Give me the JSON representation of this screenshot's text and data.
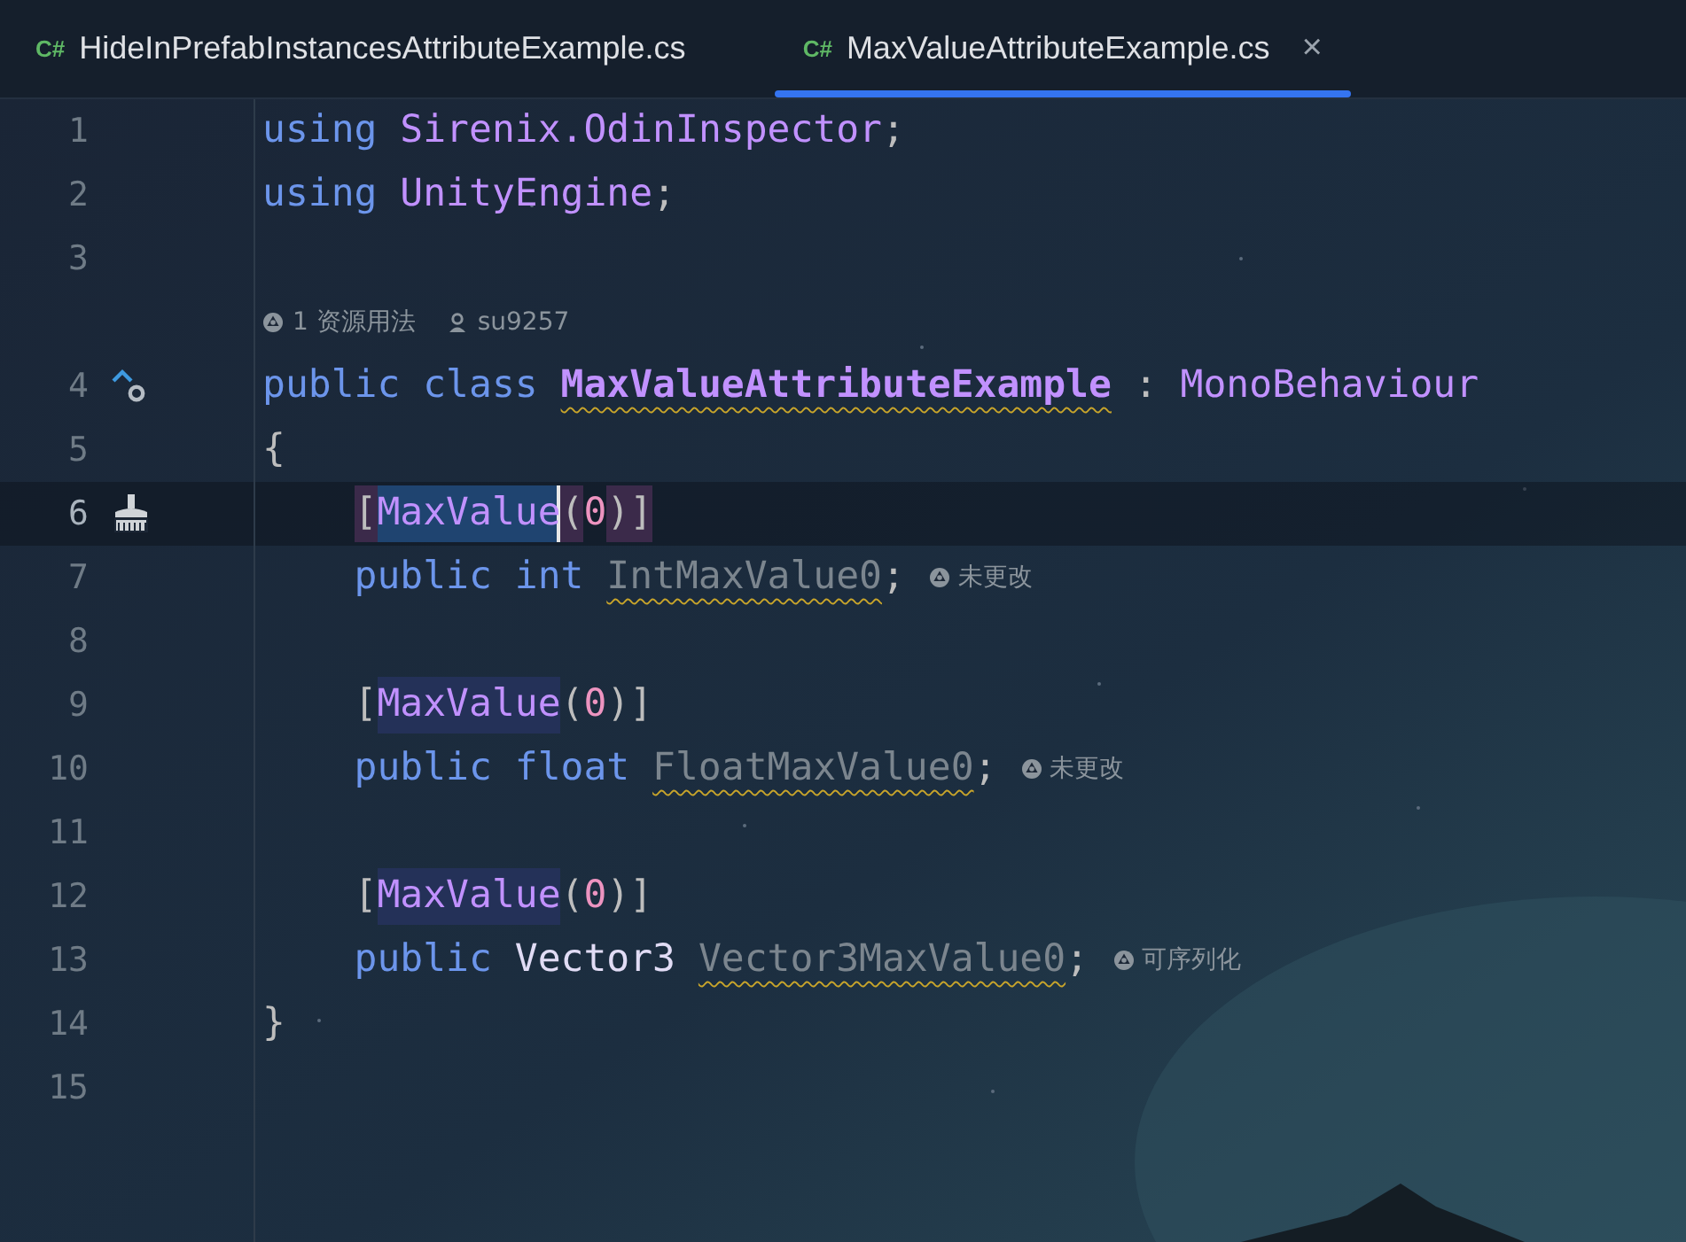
{
  "tabs": [
    {
      "badge": "C#",
      "label": "HideInPrefabInstancesAttributeExample.cs",
      "selected": false
    },
    {
      "badge": "C#",
      "label": "MaxValueAttributeExample.cs",
      "selected": true,
      "close": "×"
    }
  ],
  "editor": {
    "lines": [
      {
        "number": "1",
        "tokens": [
          {
            "kind": "keyword",
            "text": "using "
          },
          {
            "kind": "namespace",
            "text": "Sirenix.OdinInspector"
          },
          {
            "kind": "punct",
            "text": ";"
          }
        ]
      },
      {
        "number": "2",
        "tokens": [
          {
            "kind": "keyword",
            "text": "using "
          },
          {
            "kind": "namespace",
            "text": "UnityEngine"
          },
          {
            "kind": "punct",
            "text": ";"
          }
        ]
      },
      {
        "number": "3"
      },
      {
        "kind": "code_vision",
        "items": [
          {
            "kind": "usages",
            "text": "1 资源用法"
          },
          {
            "kind": "author",
            "text": "su9257"
          }
        ]
      },
      {
        "number": "4",
        "gutter": {
          "kind": "implements"
        },
        "tokens": [
          {
            "kind": "keyword",
            "text": "public class "
          },
          {
            "kind": "classname",
            "text": "MaxValueAttributeExample",
            "warning": true
          },
          {
            "kind": "punct",
            "text": " : "
          },
          {
            "kind": "type",
            "text": "MonoBehaviour"
          }
        ]
      },
      {
        "number": "5",
        "tokens": [
          {
            "kind": "punct",
            "text": "{"
          }
        ]
      },
      {
        "number": "6",
        "current": true,
        "gutter": {
          "kind": "brush"
        },
        "indented": true,
        "tokens": [
          {
            "kind": "punct",
            "text": "[",
            "brace_match": true
          },
          {
            "kind": "attribute",
            "text": "MaxValue",
            "selected": true,
            "caret": true
          },
          {
            "kind": "punct",
            "text": "(",
            "brace_match": true
          },
          {
            "kind": "number",
            "text": "0"
          },
          {
            "kind": "punct",
            "text": ")]",
            "brace_match": true
          }
        ]
      },
      {
        "number": "7",
        "indented": true,
        "tokens": [
          {
            "kind": "keyword",
            "text": "public int "
          },
          {
            "kind": "field",
            "text": "IntMaxValue0",
            "warning": true
          },
          {
            "kind": "punct",
            "text": ";"
          }
        ],
        "hint": "未更改"
      },
      {
        "number": "8"
      },
      {
        "number": "9",
        "indented": true,
        "tokens": [
          {
            "kind": "punct",
            "text": "["
          },
          {
            "kind": "attribute",
            "text": "MaxValue",
            "usage": true
          },
          {
            "kind": "punct",
            "text": "("
          },
          {
            "kind": "number",
            "text": "0"
          },
          {
            "kind": "punct",
            "text": ")]"
          }
        ]
      },
      {
        "number": "10",
        "indented": true,
        "tokens": [
          {
            "kind": "keyword",
            "text": "public float "
          },
          {
            "kind": "field",
            "text": "FloatMaxValue0",
            "warning": true
          },
          {
            "kind": "punct",
            "text": ";"
          }
        ],
        "hint": "未更改"
      },
      {
        "number": "11"
      },
      {
        "number": "12",
        "indented": true,
        "tokens": [
          {
            "kind": "punct",
            "text": "["
          },
          {
            "kind": "attribute",
            "text": "MaxValue",
            "usage": true
          },
          {
            "kind": "punct",
            "text": "("
          },
          {
            "kind": "number",
            "text": "0"
          },
          {
            "kind": "punct",
            "text": ")]"
          }
        ]
      },
      {
        "number": "13",
        "indented": true,
        "tokens": [
          {
            "kind": "keyword",
            "text": "public "
          },
          {
            "kind": "struct",
            "text": "Vector3 "
          },
          {
            "kind": "field",
            "text": "Vector3MaxValue0",
            "warning": true
          },
          {
            "kind": "punct",
            "text": ";"
          }
        ],
        "hint": "可序列化"
      },
      {
        "number": "14",
        "tokens": [
          {
            "kind": "punct",
            "text": "}"
          }
        ]
      },
      {
        "number": "15"
      }
    ]
  }
}
